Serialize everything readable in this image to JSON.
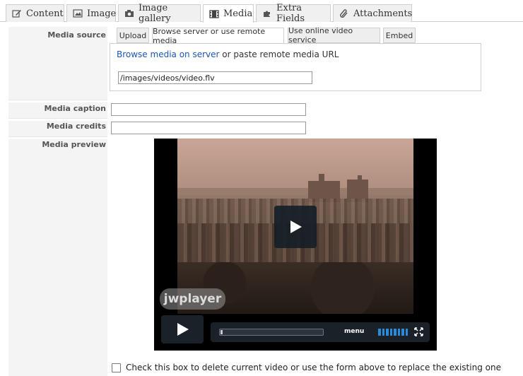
{
  "top_tabs": [
    {
      "label": "Content",
      "icon": "pencil-icon"
    },
    {
      "label": "Image",
      "icon": "image-icon"
    },
    {
      "label": "Image gallery",
      "icon": "camera-icon"
    },
    {
      "label": "Media",
      "icon": "film-icon",
      "active": true
    },
    {
      "label": "Extra Fields",
      "icon": "puzzle-icon"
    },
    {
      "label": "Attachments",
      "icon": "paperclip-icon"
    }
  ],
  "labels": {
    "media_source": "Media source",
    "media_caption": "Media caption",
    "media_credits": "Media credits",
    "media_preview": "Media preview"
  },
  "source_tabs": [
    {
      "label": "Upload"
    },
    {
      "label": "Browse server or use remote media",
      "active": true
    },
    {
      "label": "Use online video service"
    },
    {
      "label": "Embed"
    }
  ],
  "browse": {
    "link_text": "Browse media on server",
    "rest_text": " or paste remote media URL",
    "url_value": "/images/videos/video.flv"
  },
  "caption_value": "",
  "credits_value": "",
  "player": {
    "logo_text": "jwplayer",
    "menu_label": "menu",
    "progress_fraction": 0.02,
    "accent_color": "#2a8bd6"
  },
  "delete_checkbox": {
    "label": "Check this box to delete current video or use the form above to replace the existing one",
    "checked": false
  }
}
